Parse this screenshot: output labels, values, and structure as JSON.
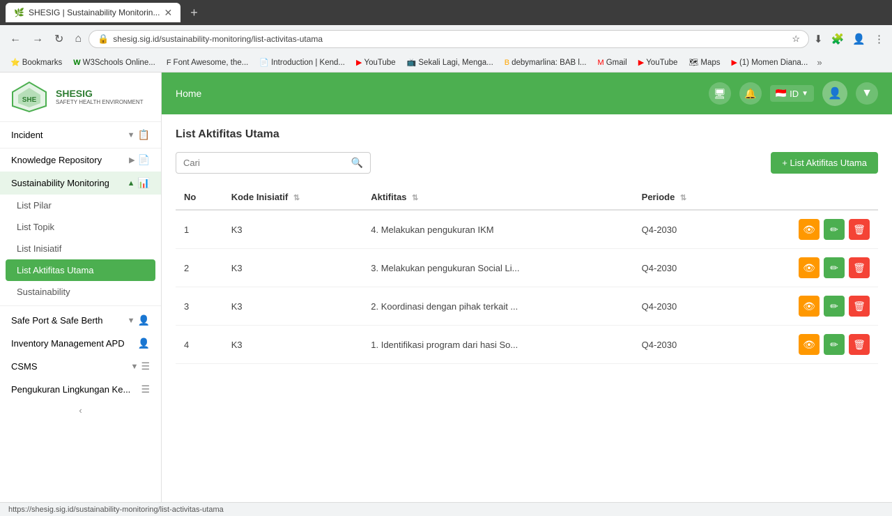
{
  "browser": {
    "tab_title": "SHESIG | Sustainability Monitorin...",
    "tab_favicon": "🌿",
    "address": "shesig.sig.id/sustainability-monitoring/list-activitas-utama",
    "new_tab_label": "+",
    "status_bar_url": "https://shesig.sig.id/sustainability-monitoring/list-activitas-utama"
  },
  "bookmarks": [
    {
      "label": "Bookmarks",
      "icon": "⭐"
    },
    {
      "label": "W3Schools Online...",
      "icon": "W"
    },
    {
      "label": "Font Awesome, the...",
      "icon": "F"
    },
    {
      "label": "Introduction | Kend...",
      "icon": "📄"
    },
    {
      "label": "YouTube",
      "icon": "▶"
    },
    {
      "label": "Sekali Lagi, Menga...",
      "icon": "📺"
    },
    {
      "label": "debymarlina: BAB l...",
      "icon": "B"
    },
    {
      "label": "Gmail",
      "icon": "M"
    },
    {
      "label": "YouTube",
      "icon": "▶"
    },
    {
      "label": "Maps",
      "icon": "🗺"
    },
    {
      "label": "(1) Momen Diana...",
      "icon": "▶"
    }
  ],
  "sidebar": {
    "logo_text": "SHESIG",
    "logo_subtitle": "SAFETY HEALTH ENVIRONMENT",
    "incident_label": "Incident",
    "knowledge_repository_label": "Knowledge Repository",
    "sustainability_monitoring_label": "Sustainability Monitoring",
    "sub_items": [
      {
        "label": "List Pilar",
        "active": false
      },
      {
        "label": "List Topik",
        "active": false
      },
      {
        "label": "List Inisiatif",
        "active": false
      },
      {
        "label": "List Aktifitas Utama",
        "active": true
      },
      {
        "label": "Sustainability",
        "active": false
      }
    ],
    "safe_port_label": "Safe Port & Safe Berth",
    "inventory_label": "Inventory Management APD",
    "csms_label": "CSMS",
    "pengukuran_label": "Pengukuran Lingkungan Ke..."
  },
  "header": {
    "home_label": "Home",
    "language": "ID"
  },
  "page": {
    "title": "List Aktifitas Utama",
    "search_placeholder": "Cari",
    "add_button_label": "+ List Aktifitas Utama",
    "table": {
      "columns": [
        {
          "label": "No",
          "sortable": false
        },
        {
          "label": "Kode Inisiatif",
          "sortable": true
        },
        {
          "label": "Aktifitas",
          "sortable": true
        },
        {
          "label": "Periode",
          "sortable": true
        },
        {
          "label": "",
          "sortable": false
        }
      ],
      "rows": [
        {
          "no": "1",
          "kode": "K3",
          "aktifitas": "4. Melakukan pengukuran IKM",
          "periode": "Q4-2030"
        },
        {
          "no": "2",
          "kode": "K3",
          "aktifitas": "3. Melakukan pengukuran Social Li...",
          "periode": "Q4-2030"
        },
        {
          "no": "3",
          "kode": "K3",
          "aktifitas": "2. Koordinasi dengan pihak terkait ...",
          "periode": "Q4-2030"
        },
        {
          "no": "4",
          "kode": "K3",
          "aktifitas": "1. Identifikasi program dari hasi So...",
          "periode": "Q4-2030"
        }
      ]
    }
  },
  "actions": {
    "view_icon": "👁",
    "edit_icon": "✏",
    "delete_icon": "🗑"
  }
}
